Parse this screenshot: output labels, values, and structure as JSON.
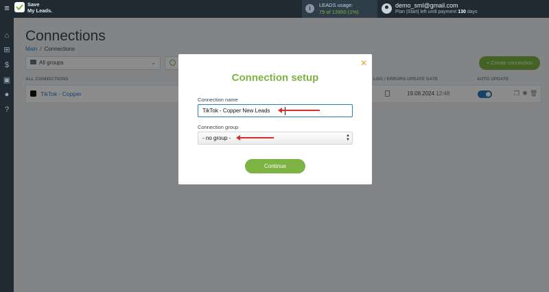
{
  "topbar": {
    "menu_icon": "hamburger-icon",
    "logo_line1": "Save",
    "logo_line2": "My Leads.",
    "leads_label": "LEADS usage:",
    "leads_count": "79 of 13950 (1%)",
    "user_email": "demo_sml@gmail.com",
    "plan_prefix": "Plan |Start| left until payment",
    "plan_days": "130",
    "plan_suffix": "days"
  },
  "sidebar": {
    "icons": [
      "home-icon",
      "sitemap-icon",
      "dollar-icon",
      "briefcase-icon",
      "user-icon",
      "help-icon"
    ]
  },
  "main": {
    "title": "Connections",
    "breadcrumb": {
      "home": "Main",
      "separator": "/",
      "current": "Connections"
    },
    "group_filter": "All groups",
    "create_button": "+ Create connection",
    "columns": {
      "all_connections": "ALL CONNECTIONS",
      "log": "LOG / ERRORS",
      "update_date": "UPDATE DATE",
      "auto_update": "AUTO UPDATE"
    },
    "rows": [
      {
        "name": "TikTok - Copper",
        "date": "19.08.2024",
        "time": "12:48",
        "auto_update": true
      }
    ]
  },
  "modal": {
    "title": "Connection setup",
    "name_label": "Connection name",
    "name_value": "TikTok - Copper New Leads",
    "group_label": "Connection group",
    "group_value": "- no group -",
    "continue_button": "Continue"
  },
  "colors": {
    "accent_green": "#7cb342",
    "link_blue": "#2a7bc0",
    "arrow_red": "#d62c2c",
    "close_orange": "#f39c35",
    "topbar_dark": "#1f2a33"
  }
}
